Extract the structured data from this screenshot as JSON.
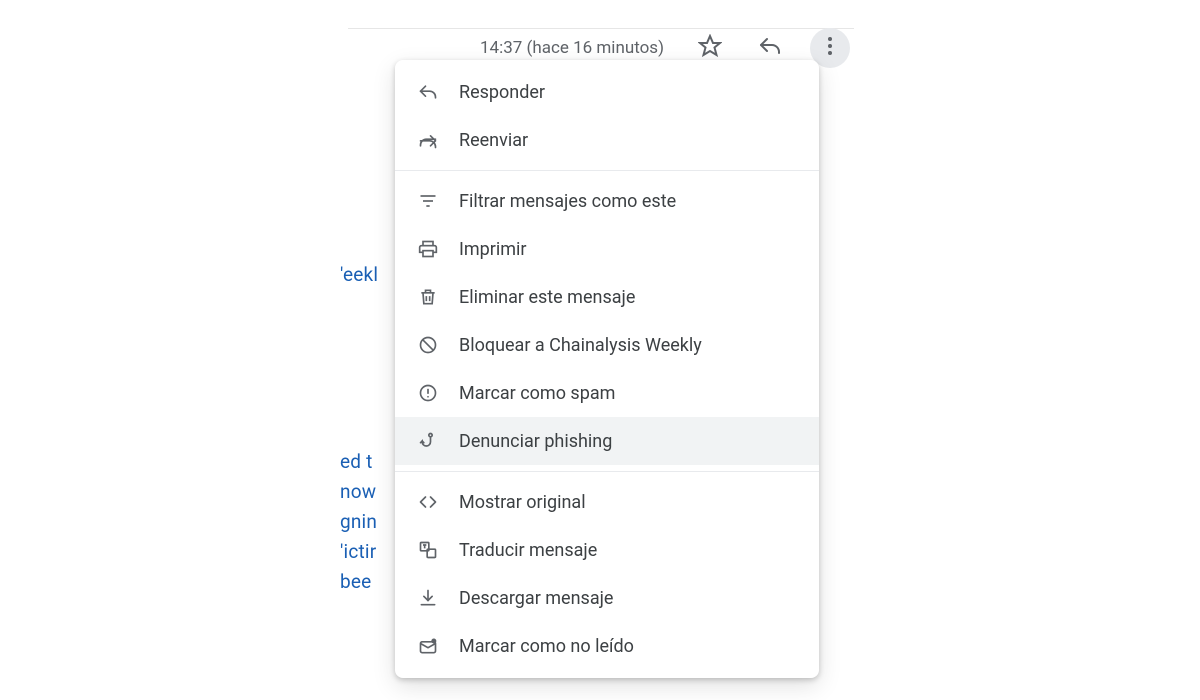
{
  "header": {
    "timestamp": "14:37 (hace 16 minutos)"
  },
  "body_fragments": {
    "line1": "'eekl",
    "line2": "ed t",
    "line3": "now",
    "line4": "gnin",
    "line5": "'ictir",
    "line6": "bee"
  },
  "menu": {
    "reply": "Responder",
    "forward": "Reenviar",
    "filter": "Filtrar mensajes como este",
    "print": "Imprimir",
    "delete": "Eliminar este mensaje",
    "block": "Bloquear a Chainalysis Weekly",
    "spam": "Marcar como spam",
    "phishing": "Denunciar phishing",
    "show_original": "Mostrar original",
    "translate": "Traducir mensaje",
    "download": "Descargar mensaje",
    "mark_unread": "Marcar como no leído"
  }
}
